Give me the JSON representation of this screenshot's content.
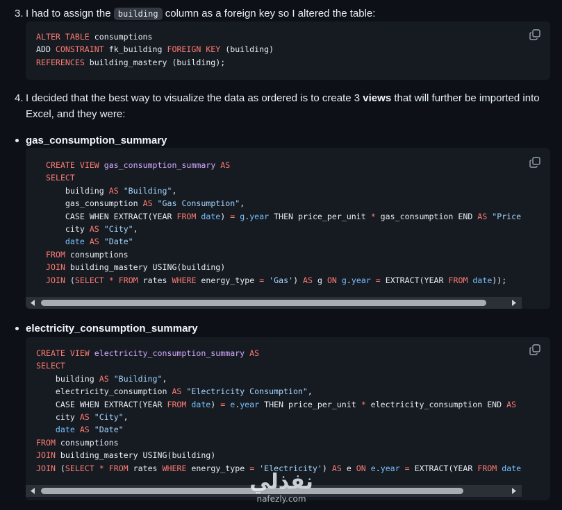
{
  "step3": {
    "number": "3.",
    "text_before": "I had to assign the",
    "code": "building",
    "text_after": "column as a foreign key so I altered the table:"
  },
  "step4": {
    "number": "4.",
    "text_before": "I decided that the best way to visualize the data as ordered is to create 3",
    "bold": "views",
    "text_after": "that will further be imported into",
    "line2": "Excel, and they were:"
  },
  "bullet1": {
    "label": "gas_consumption_summary"
  },
  "bullet2": {
    "label": "electricity_consumption_summary"
  },
  "icons": {
    "copy": "copy-icon",
    "scroll_left": "triangle-left-icon",
    "scroll_right": "triangle-right-icon"
  },
  "code_blocks": [
    {
      "lines": [
        [
          [
            "kw",
            "ALTER TABLE"
          ],
          [
            "id",
            " consumptions"
          ]
        ],
        [
          [
            "id",
            "ADD "
          ],
          [
            "kw",
            "CONSTRAINT"
          ],
          [
            "id",
            " fk_building "
          ],
          [
            "kw",
            "FOREIGN KEY"
          ],
          [
            "id",
            " (building)"
          ]
        ],
        [
          [
            "kw",
            "REFERENCES"
          ],
          [
            "id",
            " building_mastery (building);"
          ]
        ]
      ]
    },
    {
      "lines": [
        [
          [
            "kw",
            "CREATE VIEW"
          ],
          [
            "fn",
            " gas_consumption_summary "
          ],
          [
            "kw",
            "AS"
          ]
        ],
        [
          [
            "kw",
            "SELECT"
          ]
        ],
        [
          [
            "id",
            "    building "
          ],
          [
            "kw",
            "AS"
          ],
          [
            "st",
            " \"Building\""
          ],
          [
            "id",
            ","
          ]
        ],
        [
          [
            "id",
            "    gas_consumption "
          ],
          [
            "kw",
            "AS"
          ],
          [
            "st",
            " \"Gas Consumption\""
          ],
          [
            "id",
            ","
          ]
        ],
        [
          [
            "id",
            "    CASE WHEN EXTRACT(YEAR "
          ],
          [
            "kw",
            "FROM"
          ],
          [
            "nm",
            " date"
          ],
          [
            "id",
            ") "
          ],
          [
            "kw",
            "="
          ],
          [
            "nm",
            " g"
          ],
          [
            "id",
            "."
          ],
          [
            "nm",
            "year"
          ],
          [
            "id",
            " THEN price_per_unit "
          ],
          [
            "kw",
            "*"
          ],
          [
            "id",
            " gas_consumption END "
          ],
          [
            "kw",
            "AS"
          ],
          [
            "st",
            " \"Price"
          ]
        ],
        [
          [
            "id",
            "    city "
          ],
          [
            "kw",
            "AS"
          ],
          [
            "st",
            " \"City\""
          ],
          [
            "id",
            ","
          ]
        ],
        [
          [
            "nm",
            "    date "
          ],
          [
            "kw",
            "AS"
          ],
          [
            "st",
            " \"Date\""
          ]
        ],
        [
          [
            "kw",
            "FROM"
          ],
          [
            "id",
            " consumptions"
          ]
        ],
        [
          [
            "kw",
            "JOIN"
          ],
          [
            "id",
            " building_mastery USING(building)"
          ]
        ],
        [
          [
            "kw",
            "JOIN"
          ],
          [
            "id",
            " ("
          ],
          [
            "kw",
            "SELECT"
          ],
          [
            "kw",
            " *"
          ],
          [
            "kw",
            " FROM"
          ],
          [
            "id",
            " rates "
          ],
          [
            "kw",
            "WHERE"
          ],
          [
            "id",
            " energy_type "
          ],
          [
            "kw",
            "="
          ],
          [
            "st",
            " 'Gas'"
          ],
          [
            "id",
            ") "
          ],
          [
            "kw",
            "AS"
          ],
          [
            "id",
            " g "
          ],
          [
            "kw",
            "ON"
          ],
          [
            "nm",
            " g"
          ],
          [
            "id",
            "."
          ],
          [
            "nm",
            "year"
          ],
          [
            "kw",
            " ="
          ],
          [
            "id",
            " EXTRACT(YEAR "
          ],
          [
            "kw",
            "FROM"
          ],
          [
            "nm",
            " date"
          ],
          [
            "id",
            "));"
          ]
        ]
      ]
    },
    {
      "lines": [
        [
          [
            "kw",
            "CREATE VIEW"
          ],
          [
            "fn",
            " electricity_consumption_summary "
          ],
          [
            "kw",
            "AS"
          ]
        ],
        [
          [
            "kw",
            "SELECT"
          ]
        ],
        [
          [
            "id",
            "    building "
          ],
          [
            "kw",
            "AS"
          ],
          [
            "st",
            " \"Building\""
          ],
          [
            "id",
            ","
          ]
        ],
        [
          [
            "id",
            "    electricity_consumption "
          ],
          [
            "kw",
            "AS"
          ],
          [
            "st",
            " \"Electricity Consumption\""
          ],
          [
            "id",
            ","
          ]
        ],
        [
          [
            "id",
            "    CASE WHEN EXTRACT(YEAR "
          ],
          [
            "kw",
            "FROM"
          ],
          [
            "nm",
            " date"
          ],
          [
            "id",
            ") "
          ],
          [
            "kw",
            "="
          ],
          [
            "nm",
            " e"
          ],
          [
            "id",
            "."
          ],
          [
            "nm",
            "year"
          ],
          [
            "id",
            " THEN price_per_unit "
          ],
          [
            "kw",
            "*"
          ],
          [
            "id",
            " electricity_consumption END "
          ],
          [
            "kw",
            "AS"
          ]
        ],
        [
          [
            "id",
            "    city "
          ],
          [
            "kw",
            "AS"
          ],
          [
            "st",
            " \"City\""
          ],
          [
            "id",
            ","
          ]
        ],
        [
          [
            "nm",
            "    date "
          ],
          [
            "kw",
            "AS"
          ],
          [
            "st",
            " \"Date\""
          ]
        ],
        [
          [
            "kw",
            "FROM"
          ],
          [
            "id",
            " consumptions"
          ]
        ],
        [
          [
            "kw",
            "JOIN"
          ],
          [
            "id",
            " building_mastery USING(building)"
          ]
        ],
        [
          [
            "kw",
            "JOIN"
          ],
          [
            "id",
            " ("
          ],
          [
            "kw",
            "SELECT"
          ],
          [
            "kw",
            " *"
          ],
          [
            "kw",
            " FROM"
          ],
          [
            "id",
            " rates "
          ],
          [
            "kw",
            "WHERE"
          ],
          [
            "id",
            " energy_type "
          ],
          [
            "kw",
            "="
          ],
          [
            "st",
            " 'Electricity'"
          ],
          [
            "id",
            ") "
          ],
          [
            "kw",
            "AS"
          ],
          [
            "id",
            " e "
          ],
          [
            "kw",
            "ON"
          ],
          [
            "nm",
            " e"
          ],
          [
            "id",
            "."
          ],
          [
            "nm",
            "year"
          ],
          [
            "kw",
            " ="
          ],
          [
            "id",
            " EXTRACT(YEAR "
          ],
          [
            "kw",
            "FROM"
          ],
          [
            "nm",
            " date"
          ]
        ]
      ]
    }
  ],
  "colors": {
    "background": "#0d1117",
    "code_bg": "#161b22",
    "keyword": "#ff7b72",
    "function_name": "#d2a8ff",
    "string": "#a5d6ff",
    "identifier": "#79c0ff"
  },
  "watermark": {
    "arabic": "نفذلي",
    "latin": "nafezly.com"
  }
}
